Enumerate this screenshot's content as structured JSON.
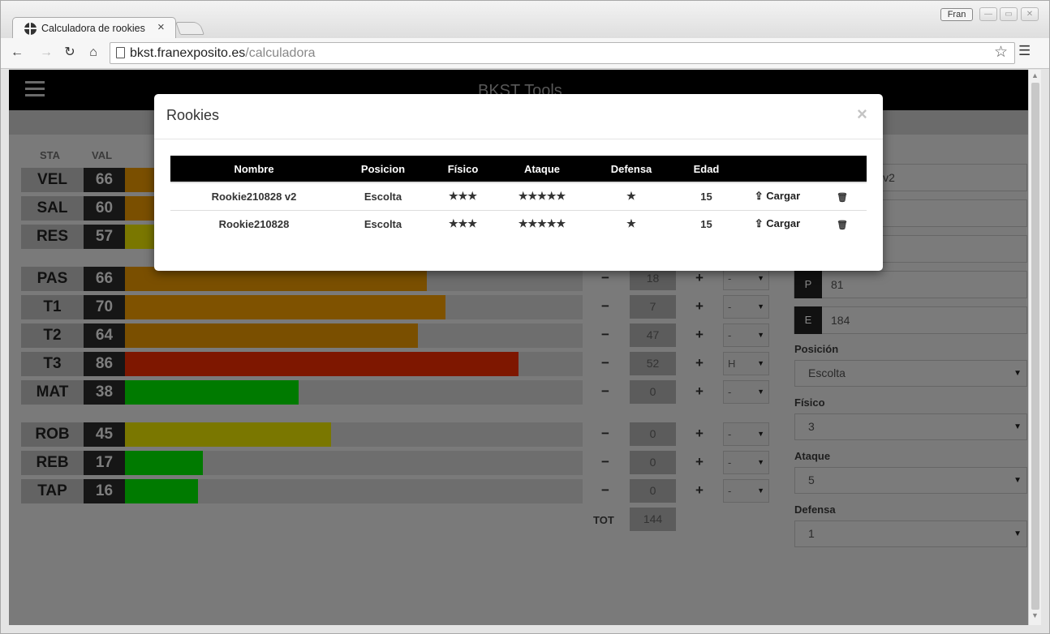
{
  "browser": {
    "tab_title": "Calculadora de rookies",
    "tab_close": "×",
    "profile_name": "Fran",
    "url_host": "bkst.franexposito.es",
    "url_path": "/calculadora"
  },
  "app": {
    "title": "BKST Tools"
  },
  "stats": {
    "header_sta": "STA",
    "header_val": "VAL",
    "rows": [
      {
        "name": "VEL",
        "value": "66"
      },
      {
        "name": "SAL",
        "value": "60"
      },
      {
        "name": "RES",
        "value": "57"
      },
      {
        "name": "PAS",
        "value": "66",
        "points": "18",
        "option": "-"
      },
      {
        "name": "T1",
        "value": "70",
        "points": "7",
        "option": "-"
      },
      {
        "name": "T2",
        "value": "64",
        "points": "47",
        "option": "-"
      },
      {
        "name": "T3",
        "value": "86",
        "points": "52",
        "option": "H"
      },
      {
        "name": "MAT",
        "value": "38",
        "points": "0",
        "option": "-"
      },
      {
        "name": "ROB",
        "value": "45",
        "points": "0",
        "option": "-"
      },
      {
        "name": "REB",
        "value": "17",
        "points": "0",
        "option": "-"
      },
      {
        "name": "TAP",
        "value": "16",
        "points": "0",
        "option": "-"
      }
    ],
    "minus": "−",
    "plus": "+",
    "total_label": "TOT",
    "total_value": "144"
  },
  "form": {
    "name_value": "Rookie210828 v2",
    "p_tag": "P",
    "p_value": "81",
    "e_tag": "E",
    "e_value": "184",
    "posicion_label": "Posición",
    "posicion_value": "Escolta",
    "fisico_label": "Físico",
    "fisico_value": "3",
    "ataque_label": "Ataque",
    "ataque_value": "5",
    "defensa_label": "Defensa",
    "defensa_value": "1"
  },
  "modal": {
    "title": "Rookies",
    "close": "×",
    "columns": [
      "Nombre",
      "Posicion",
      "Físico",
      "Ataque",
      "Defensa",
      "Edad"
    ],
    "rows": [
      {
        "nombre": "Rookie210828 v2",
        "posicion": "Escolta",
        "fisico": "★★★",
        "ataque": "★★★★★",
        "defensa": "★",
        "edad": "15",
        "action": "Cargar"
      },
      {
        "nombre": "Rookie210828",
        "posicion": "Escolta",
        "fisico": "★★★",
        "ataque": "★★★★★",
        "defensa": "★",
        "edad": "15",
        "action": "Cargar"
      }
    ]
  },
  "colors": {
    "bar_orange": "#7a4f00",
    "bar_brown": "#7f5200",
    "bar_red": "#7e1700",
    "bar_green": "#007a00",
    "bar_olive": "#7a7700"
  }
}
